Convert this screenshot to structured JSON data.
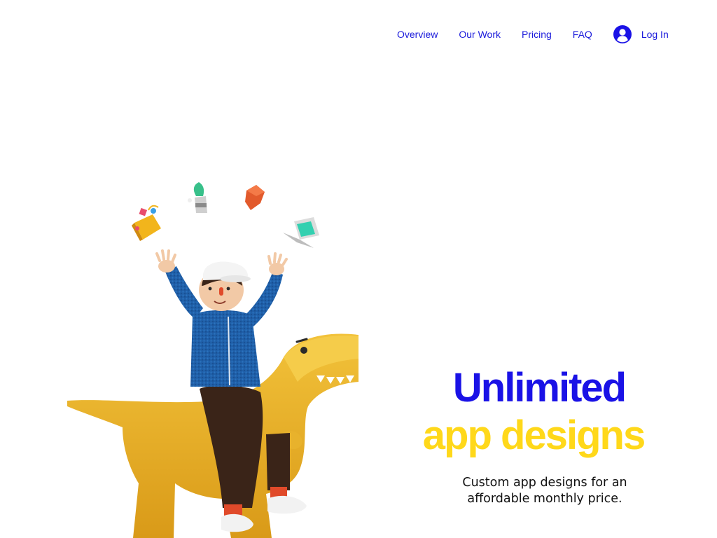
{
  "nav": {
    "items": [
      {
        "label": "Overview"
      },
      {
        "label": "Our Work"
      },
      {
        "label": "Pricing"
      },
      {
        "label": "FAQ"
      }
    ],
    "login": {
      "label": "Log In",
      "icon": "user-avatar-icon"
    }
  },
  "hero": {
    "illustration": "kid-riding-dinosaur-illustration",
    "headline_line1": "Unlimited",
    "headline_line2": "app designs",
    "subtitle_line1": "Custom app designs for an",
    "subtitle_line2": "affordable monthly price."
  },
  "colors": {
    "primary_blue": "#1a12e6",
    "accent_yellow": "#ffd81a",
    "nav_blue": "#1a1adb",
    "background": "#ffffff"
  }
}
